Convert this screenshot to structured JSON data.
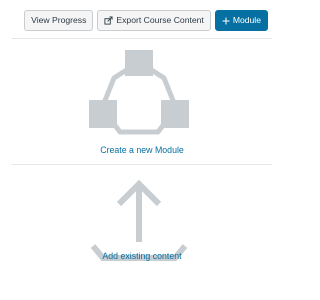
{
  "toolbar": {
    "view_progress_label": "View Progress",
    "export_label": "Export Course Content",
    "module_label": "Module",
    "export_icon": "export-icon",
    "add_icon": "plus-icon"
  },
  "empty_state": {
    "create_module_label": "Create a new Module",
    "create_illustration": "module-diagram-icon",
    "add_existing_label": "Add existing content",
    "add_illustration": "upload-tray-icon"
  },
  "colors": {
    "primary": "#0770a3",
    "illustration_gray": "#c8cdd1",
    "link": "#0770a3"
  }
}
